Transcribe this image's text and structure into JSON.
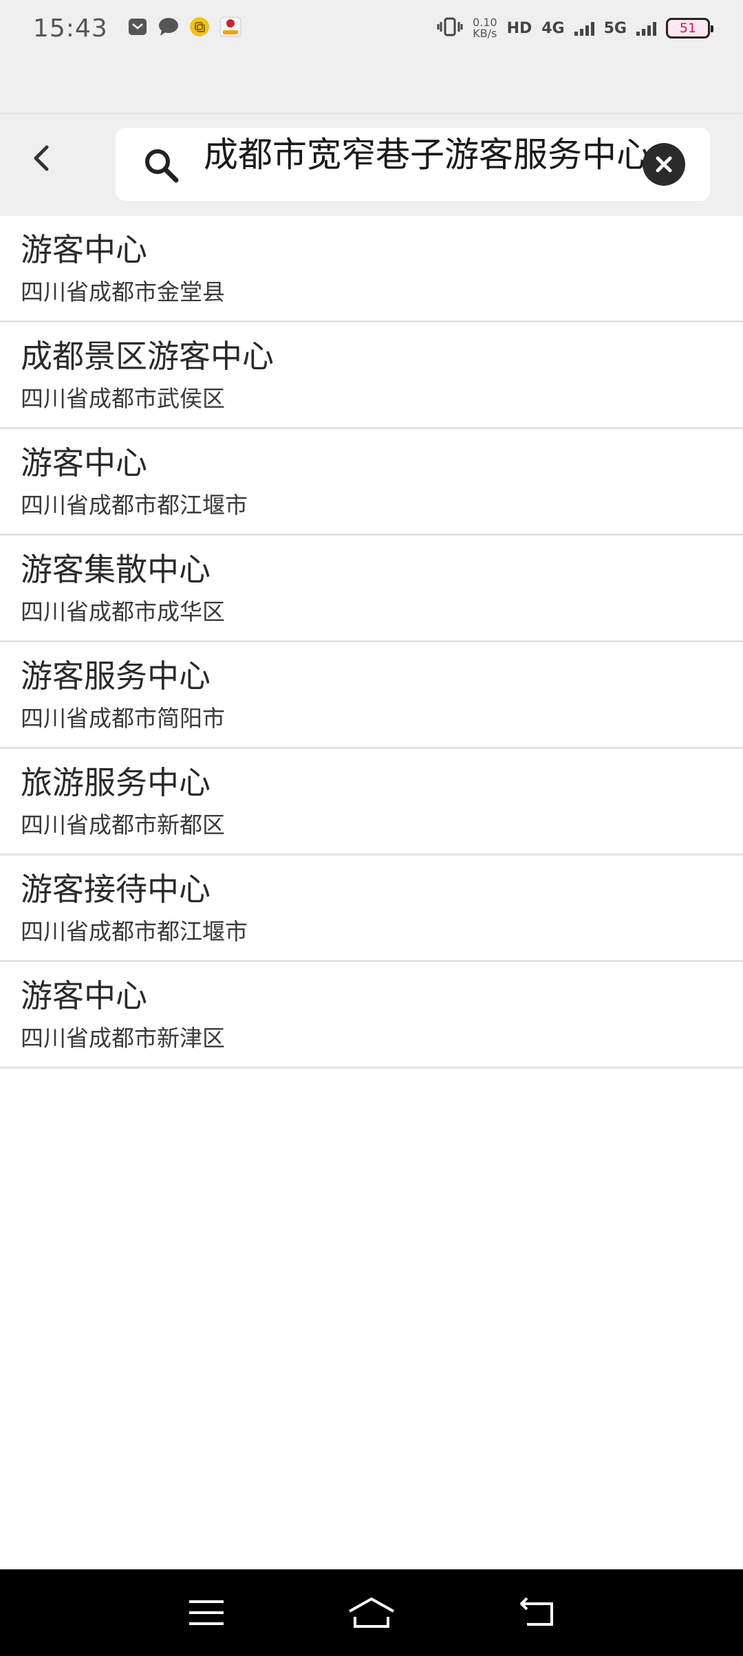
{
  "status_bar": {
    "time": "15:43",
    "net_speed_value": "0.10",
    "net_speed_unit": "KB/s",
    "hd_label": "HD",
    "sim1_label": "4G",
    "sim2_label": "5G",
    "battery": "51"
  },
  "search": {
    "query": "成都市宽窄巷子游客服务中心"
  },
  "results": [
    {
      "title": "游客中心",
      "subtitle": "四川省成都市金堂县"
    },
    {
      "title": "成都景区游客中心",
      "subtitle": "四川省成都市武侯区"
    },
    {
      "title": "游客中心",
      "subtitle": "四川省成都市都江堰市"
    },
    {
      "title": "游客集散中心",
      "subtitle": "四川省成都市成华区"
    },
    {
      "title": "游客服务中心",
      "subtitle": "四川省成都市简阳市"
    },
    {
      "title": "旅游服务中心",
      "subtitle": "四川省成都市新都区"
    },
    {
      "title": "游客接待中心",
      "subtitle": "四川省成都市都江堰市"
    },
    {
      "title": "游客中心",
      "subtitle": "四川省成都市新津区"
    }
  ],
  "icons": {
    "back": "chevron-left-icon",
    "search": "search-icon",
    "clear": "close-icon",
    "nav_menu": "menu-icon",
    "nav_home": "home-icon",
    "nav_back": "back-icon"
  }
}
